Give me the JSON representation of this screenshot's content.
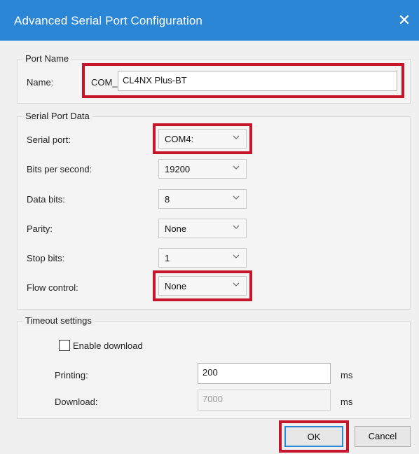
{
  "window": {
    "title": "Advanced Serial Port Configuration",
    "close_glyph": "✕"
  },
  "port_name": {
    "legend": "Port Name",
    "name_label": "Name:",
    "prefix": "COM_",
    "value": "CL4NX Plus-BT"
  },
  "serial": {
    "legend": "Serial Port Data",
    "fields": [
      {
        "label": "Serial port:",
        "value": "COM4:"
      },
      {
        "label": "Bits per second:",
        "value": "19200"
      },
      {
        "label": "Data bits:",
        "value": "8"
      },
      {
        "label": "Parity:",
        "value": "None"
      },
      {
        "label": "Stop bits:",
        "value": "1"
      },
      {
        "label": "Flow control:",
        "value": "None"
      }
    ]
  },
  "timeout": {
    "legend": "Timeout settings",
    "enable_download_label": "Enable download",
    "enable_download_checked": false,
    "printing_label": "Printing:",
    "printing_value": "200",
    "printing_unit": "ms",
    "download_label": "Download:",
    "download_value": "7000",
    "download_unit": "ms"
  },
  "buttons": {
    "ok": "OK",
    "cancel": "Cancel"
  },
  "colors": {
    "titlebar": "#2b86d6",
    "highlight": "#c7162b"
  },
  "icons": {
    "close": "close-icon",
    "dropdown": "chevron-down-icon"
  }
}
